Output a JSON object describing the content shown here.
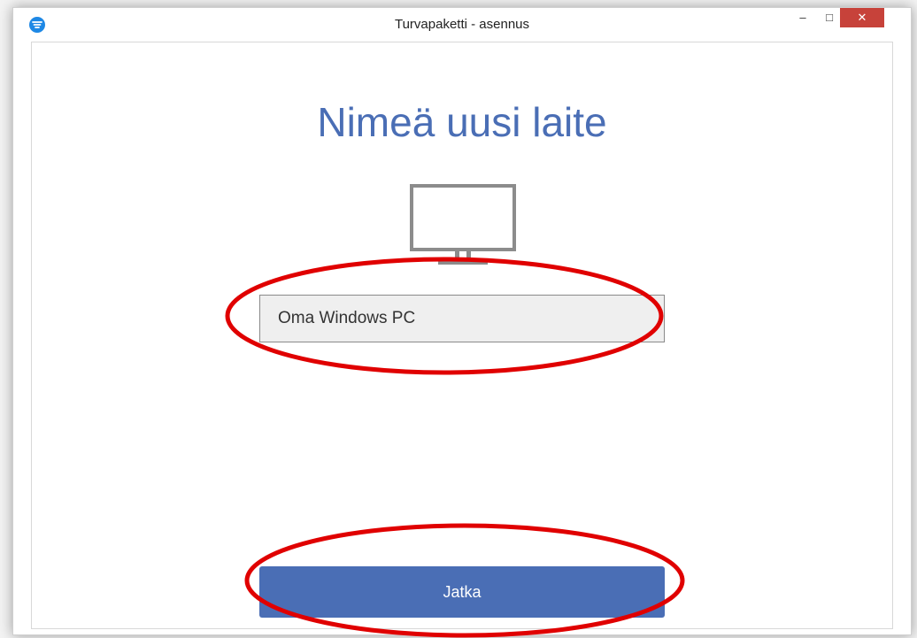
{
  "window": {
    "title": "Turvapaketti - asennus",
    "minimize_glyph": "–",
    "maximize_glyph": "□",
    "close_glyph": "✕"
  },
  "main": {
    "heading": "Nimeä uusi laite",
    "device_icon": "monitor-icon",
    "device_name_value": "Oma Windows PC",
    "continue_label": "Jatka"
  },
  "colors": {
    "accent": "#4a6eb5",
    "close_button": "#c7423a",
    "annotation": "#e00000"
  }
}
